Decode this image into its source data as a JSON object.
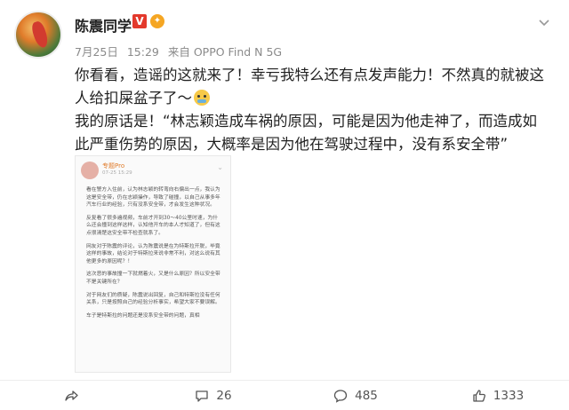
{
  "post": {
    "author": "陈震同学",
    "verified_badge": "V",
    "date": "7月25日",
    "time": "15:29",
    "source": "来自 OPPO Find N 5G",
    "paragraph1": "你看看，造谣的这就来了！幸亏我特么还有点发声能力！不然真的就被这人给扣屎盆子了～",
    "paragraph2": "我的原话是！“林志颖造成车祸的原因，可能是因为他走神了，而造成如此严重伤势的原因，大概率是因为他在驾驶过程中，没有系安全带”"
  },
  "embedded_screenshot": {
    "name": "专题Pro",
    "time": "07-25 15:29",
    "paragraphs": [
      "看在警方入住前，认为林志颖的转弯向右偏出一点，我认为这是安全带，仍在志颖操作，导致了碰撞，以自己从事多年汽车行业的经验，只有没系安全带，才会发生这种状况。",
      "反复看了很多遍视频，车前才开到30～40公里时速，为什么还会撞到这样这样，认知他开车的本人才知道了，但有这点很清楚这安全带不检查就系了。",
      "网友对于陈震的评论，认为陈震说是在为特斯拉开脱，毕竟这样的事故，结论对于特斯拉来说非常不利，对这么说有其他更多的原因呢？！",
      "这次恶的事故撞一下就燃着火，又是什么原因？所以安全带不是关键所在？",
      "对于网友们的质疑，陈震说出回复，自己和特斯拉没有任何关系，只是按照自己的经验分析事实，希望大家不要误解。",
      "车子是特斯拉的问题还是没系安全带的问题，真相"
    ]
  },
  "actions": {
    "share": "",
    "comments": "26",
    "reposts_label": "485",
    "likes": "1333"
  },
  "colors": {
    "verified": "#e3392c",
    "meta_text": "#8a8a8a",
    "name_orange": "#e07b2a"
  }
}
